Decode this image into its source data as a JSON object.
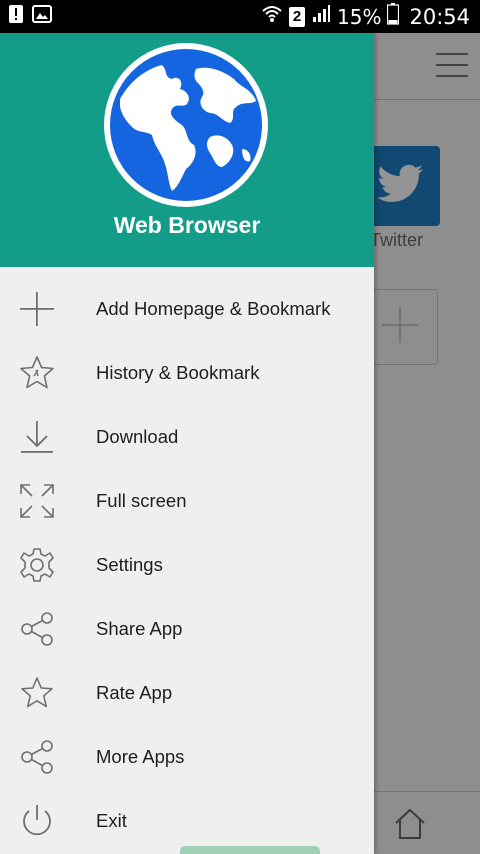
{
  "status_bar": {
    "sim_slot": "2",
    "battery_percent": "15%",
    "time": "20:54",
    "icons": [
      "alert-icon",
      "image-icon",
      "wifi-icon",
      "signal-icon",
      "battery-icon"
    ]
  },
  "background": {
    "twitter_label": "Twitter"
  },
  "drawer": {
    "app_name": "Web Browser",
    "header_color": "#139c88",
    "items": [
      {
        "label": "Add Homepage & Bookmark",
        "icon": "plus-icon"
      },
      {
        "label": "History & Bookmark",
        "icon": "star-history-icon"
      },
      {
        "label": "Download",
        "icon": "download-icon"
      },
      {
        "label": "Full screen",
        "icon": "fullscreen-icon"
      },
      {
        "label": "Settings",
        "icon": "gear-icon"
      },
      {
        "label": "Share App",
        "icon": "share-icon"
      },
      {
        "label": "Rate App",
        "icon": "star-icon"
      },
      {
        "label": "More Apps",
        "icon": "share-icon"
      },
      {
        "label": "Exit",
        "icon": "power-icon"
      }
    ]
  }
}
